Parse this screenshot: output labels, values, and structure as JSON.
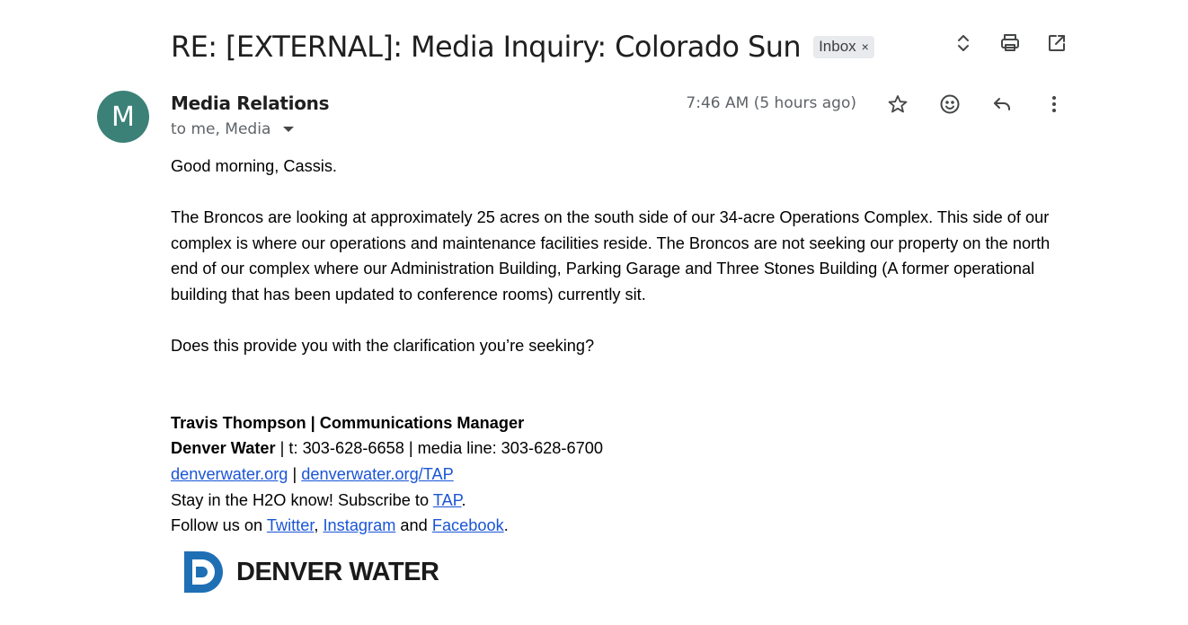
{
  "email": {
    "subject": "RE: [EXTERNAL]: Media Inquiry: Colorado Sun",
    "label": "Inbox",
    "label_remove": "×",
    "sender_initial": "M",
    "sender_name": "Media Relations",
    "recipients": "to me, Media",
    "timestamp": "7:46 AM (5 hours ago)",
    "avatar_color": "#3b8177"
  },
  "body": {
    "greeting": "Good morning, Cassis.",
    "paragraph1": "The Broncos are looking at approximately 25 acres on the south side of our 34-acre Operations Complex. This side of our complex is where our operations and maintenance facilities reside. The Broncos are not seeking our property on the north end of our complex where our Administration Building, Parking Garage and Three Stones Building (A former operational building that has been updated to conference rooms) currently sit.",
    "question": "Does this provide you with the clarification you’re seeking?"
  },
  "signature": {
    "name_title": "Travis Thompson | Communications Manager",
    "org": "Denver Water",
    "contact": " | t: 303-628-6658 | media line: 303-628-6700",
    "link1": "denverwater.org",
    "sep": " | ",
    "link2": "denverwater.org/TAP",
    "subscribe_prefix": "Stay in the H2O know! Subscribe to ",
    "subscribe_link": "TAP",
    "subscribe_suffix": ".",
    "follow_prefix": "Follow us on ",
    "twitter": "Twitter",
    "comma": ", ",
    "instagram": "Instagram",
    "and": " and ",
    "facebook": "Facebook",
    "follow_suffix": ".",
    "logo_text": "DENVER WATER",
    "logo_color": "#1f6fb5",
    "link_color": "#1a55d6"
  },
  "icons": {
    "top": [
      "expand-collapse-icon",
      "print-icon",
      "open-in-new-window-icon"
    ],
    "message": [
      "star-icon",
      "emoji-reaction-icon",
      "reply-icon",
      "more-options-icon"
    ]
  }
}
